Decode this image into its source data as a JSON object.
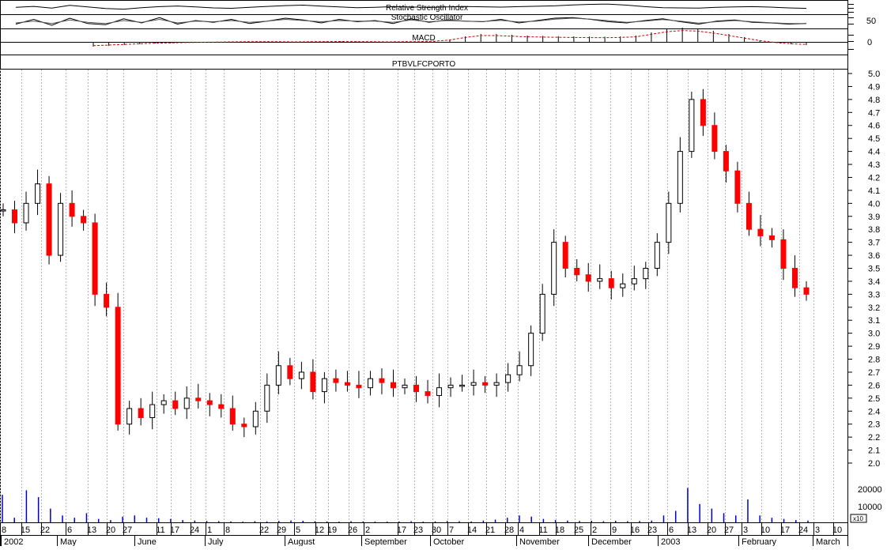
{
  "chart_data": [
    {
      "type": "line",
      "title": "Relative Strength Index",
      "series": [
        {
          "name": "RSI",
          "values": [
            55,
            62,
            48,
            70,
            58,
            45,
            40,
            52,
            60,
            65,
            58,
            50,
            47,
            55,
            62,
            68,
            72,
            64,
            58,
            52,
            55,
            60,
            57,
            54,
            58,
            61,
            59,
            56,
            60,
            63,
            66,
            74,
            78,
            80,
            72,
            60,
            52,
            50,
            48,
            55,
            58,
            60,
            56,
            50,
            46
          ]
        }
      ]
    },
    {
      "type": "line",
      "title": "Stochastic Oscillator",
      "ytick_labels": [
        "50"
      ],
      "series": [
        {
          "name": "%K",
          "values": [
            30,
            70,
            20,
            80,
            35,
            25,
            75,
            40,
            85,
            30,
            60,
            45,
            70,
            35,
            55,
            80,
            65,
            40,
            70,
            50,
            60,
            35,
            75,
            45,
            65,
            55,
            50,
            70,
            40,
            60,
            80,
            85,
            70,
            50,
            40,
            60,
            75,
            50,
            30,
            55,
            65,
            45,
            40,
            30,
            35
          ]
        },
        {
          "name": "%D",
          "values": [
            40,
            55,
            35,
            65,
            45,
            35,
            60,
            45,
            70,
            40,
            55,
            50,
            60,
            45,
            55,
            70,
            60,
            50,
            60,
            55,
            55,
            45,
            65,
            50,
            60,
            55,
            52,
            62,
            48,
            55,
            72,
            80,
            72,
            58,
            45,
            55,
            68,
            55,
            38,
            50,
            60,
            50,
            42,
            35,
            35
          ]
        }
      ]
    },
    {
      "type": "bar",
      "title": "MACD",
      "ytick_labels": [
        "0"
      ],
      "values": [
        -0.3,
        -0.25,
        -0.2,
        -0.15,
        -0.1,
        -0.08,
        -0.05,
        -0.03,
        -0.02,
        0,
        0.01,
        0.02,
        0.01,
        0,
        0.01,
        0.02,
        0.03,
        0.02,
        0.01,
        0,
        0.01,
        0.02,
        0.05,
        0.15,
        0.35,
        0.5,
        0.5,
        0.45,
        0.4,
        0.38,
        0.36,
        0.35,
        0.34,
        0.33,
        0.35,
        0.4,
        0.6,
        0.8,
        0.9,
        0.85,
        0.7,
        0.5,
        0.3,
        0.1,
        -0.05,
        -0.15,
        -0.2
      ]
    },
    {
      "type": "bar",
      "title": "PTBVLFCPORTO",
      "ylim": [
        2.0,
        5.0
      ],
      "ytick_labels": [
        "5.0",
        "4.9",
        "4.8",
        "4.7",
        "4.6",
        "4.5",
        "4.4",
        "4.3",
        "4.2",
        "4.1",
        "4.0",
        "3.9",
        "3.8",
        "3.7",
        "3.6",
        "3.5",
        "3.4",
        "3.3",
        "3.2",
        "3.1",
        "3.0",
        "2.9",
        "2.8",
        "2.7",
        "2.6",
        "2.5",
        "2.4",
        "2.3",
        "2.2",
        "2.1",
        "2.0"
      ],
      "series": [
        {
          "name": "close",
          "values": [
            3.95,
            3.85,
            4.0,
            4.15,
            3.6,
            4.0,
            3.9,
            3.85,
            3.3,
            3.2,
            2.3,
            2.42,
            2.35,
            2.45,
            2.48,
            2.42,
            2.5,
            2.48,
            2.45,
            2.42,
            2.3,
            2.28,
            2.4,
            2.6,
            2.75,
            2.65,
            2.7,
            2.55,
            2.65,
            2.62,
            2.6,
            2.58,
            2.65,
            2.62,
            2.58,
            2.6,
            2.55,
            2.52,
            2.58,
            2.6,
            2.6,
            2.62,
            2.6,
            2.62,
            2.68,
            2.75,
            3.0,
            3.3,
            3.7,
            3.5,
            3.45,
            3.4,
            3.42,
            3.35,
            3.38,
            3.42,
            3.5,
            3.7,
            4.0,
            4.4,
            4.8,
            4.6,
            4.4,
            4.25,
            4.0,
            3.8,
            3.75,
            3.72,
            3.5,
            3.35,
            3.3
          ]
        }
      ]
    },
    {
      "type": "bar",
      "title": "Volume",
      "ytick_labels": [
        "20000",
        "10000"
      ],
      "scale_label": "x10",
      "values": [
        12000,
        2000,
        14000,
        11000,
        6000,
        3000,
        2000,
        4000,
        1500,
        1000,
        2500,
        3000,
        2000,
        1800,
        1500,
        1000,
        800,
        600,
        500,
        400,
        300,
        500,
        400,
        600,
        800,
        700,
        500,
        400,
        300,
        500,
        400,
        300,
        300,
        400,
        500,
        300,
        400,
        600,
        500,
        400,
        800,
        1200,
        2000,
        3000,
        2500,
        1500,
        1000,
        800,
        600,
        700,
        500,
        700,
        500,
        600,
        800,
        3000,
        5000,
        15000,
        8000,
        6000,
        4000,
        3000,
        10000,
        3000,
        2000,
        1500,
        1000,
        800
      ]
    }
  ],
  "axis": {
    "day_labels": [
      "8",
      "15",
      "22",
      "6",
      "13",
      "20",
      "27",
      "11",
      "17",
      "24",
      "1",
      "8",
      "22",
      "29",
      "5",
      "12",
      "19",
      "26",
      "2",
      "17",
      "23",
      "30",
      "7",
      "14",
      "21",
      "28",
      "4",
      "11",
      "18",
      "25",
      "2",
      "9",
      "16",
      "23",
      "6",
      "13",
      "20",
      "27",
      "3",
      "10",
      "17",
      "24",
      "3",
      "10"
    ],
    "month_labels": [
      "2002",
      "May",
      "June",
      "July",
      "August",
      "September",
      "October",
      "November",
      "December",
      "2003",
      "February",
      "March"
    ]
  },
  "colors": {
    "up": "#ffffff",
    "down": "#ff0000",
    "dark": "#000000",
    "grid": "#b4b4b4",
    "signal": "#cc0000"
  }
}
